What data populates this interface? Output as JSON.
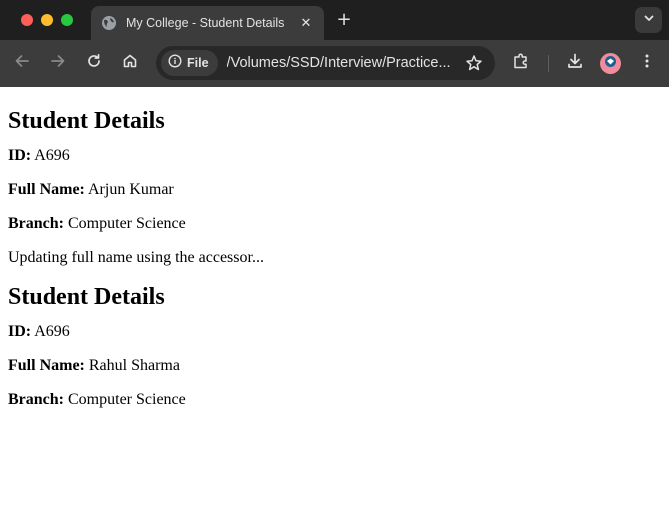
{
  "window": {
    "tab_title": "My College - Student Details",
    "tab_close_glyph": "✕",
    "new_tab_glyph": "+"
  },
  "toolbar": {
    "chip_label": "File",
    "url": "/Volumes/SSD/Interview/Practice..."
  },
  "icons": {
    "back": "back-arrow-icon",
    "forward": "forward-arrow-icon",
    "reload": "reload-icon",
    "home": "home-icon",
    "info": "info-icon",
    "star": "star-icon",
    "extensions": "puzzle-icon",
    "download": "download-icon",
    "menu": "kebab-menu-icon"
  },
  "colors": {
    "tabstrip_bg": "#1f1f1f",
    "toolbar_bg": "#3c3c3c",
    "omnibox_bg": "#282828",
    "avatar_bg": "#f28b9b"
  },
  "page": {
    "before": {
      "heading": "Student Details",
      "id_label": "ID:",
      "id_value": " A696",
      "name_label": "Full Name:",
      "name_value": " Arjun Kumar",
      "branch_label": "Branch:",
      "branch_value": " Computer Science"
    },
    "message": "Updating full name using the accessor...",
    "after": {
      "heading": "Student Details",
      "id_label": "ID:",
      "id_value": " A696",
      "name_label": "Full Name:",
      "name_value": " Rahul Sharma",
      "branch_label": "Branch:",
      "branch_value": " Computer Science"
    }
  }
}
